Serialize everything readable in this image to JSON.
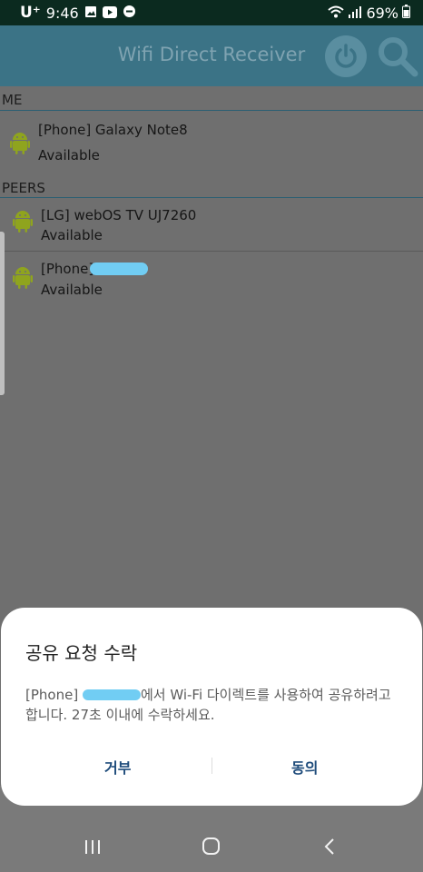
{
  "status_bar": {
    "carrier": "U⁺",
    "time": "9:46",
    "battery": "69%",
    "icons": [
      "gallery-icon",
      "youtube-icon",
      "message-icon",
      "wifi-icon",
      "signal-icon",
      "battery-icon"
    ]
  },
  "app_bar": {
    "title": "Wifi Direct Receiver",
    "power_icon": "power-icon",
    "search_icon": "search-icon"
  },
  "sections": {
    "me": {
      "header": "ME",
      "items": [
        {
          "name": "[Phone] Galaxy Note8",
          "status": "Available"
        }
      ]
    },
    "peers": {
      "header": "PEERS",
      "items": [
        {
          "name": "[LG] webOS TV UJ7260",
          "status": "Available"
        },
        {
          "name": "[Phone]",
          "status": "Available"
        }
      ]
    }
  },
  "dialog": {
    "title": "공유 요청 수락",
    "message_prefix": "[Phone]",
    "message_suffix": "에서 Wi-Fi 다이렉트를 사용하여 공유하려고 합니다. 27초 이내에 수락하세요.",
    "deny_label": "거부",
    "accept_label": "동의"
  },
  "nav_bar": {
    "recents_icon": "recents-icon",
    "home_icon": "home-icon",
    "back_icon": "back-icon"
  },
  "colors": {
    "status_bar_bg": "#0b2a1f",
    "app_bar_bg": "#3b7386",
    "overlay_bg": "#6f6f6f",
    "dialog_button_text": "#1f4c7b",
    "android_green": "#8fa41e",
    "redaction": "#71cdf3"
  }
}
